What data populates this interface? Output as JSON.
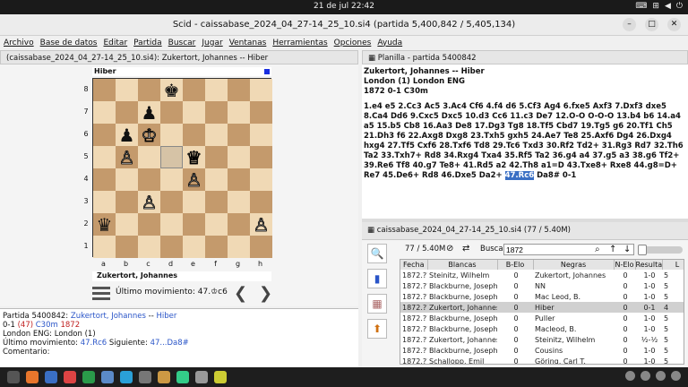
{
  "system": {
    "clock": "21 de jul  22:42",
    "tray_icons": [
      "language-icon",
      "network-icon",
      "volume-icon",
      "power-icon"
    ]
  },
  "window": {
    "title": "Scid - caissabase_2024_04_27-14_25_10.si4 (partida 5,400,842 / 5,405,134)",
    "controls": [
      "minimize-icon",
      "maximize-icon",
      "close-icon"
    ]
  },
  "menu": [
    "Archivo",
    "Base de datos",
    "Editar",
    "Partida",
    "Buscar",
    "Jugar",
    "Ventanas",
    "Herramientas",
    "Opciones",
    "Ayuda"
  ],
  "board_tab": {
    "label": "(caissabase_2024_04_27-14_25_10.si4): Zukertort, Johannes -- Hiber"
  },
  "board": {
    "top_player": "Hiber",
    "bottom_player": "Zukertort, Johannes",
    "ranks": [
      "8",
      "7",
      "6",
      "5",
      "4",
      "3",
      "2",
      "1"
    ],
    "files": [
      "a",
      "b",
      "c",
      "d",
      "e",
      "f",
      "g",
      "h"
    ],
    "last_move_label": "Último movimiento: 47.♔c6",
    "pieces": [
      {
        "square": "d8",
        "glyph": "♚",
        "color": "black"
      },
      {
        "square": "c7",
        "glyph": "♟",
        "color": "black"
      },
      {
        "square": "b6",
        "glyph": "♟",
        "color": "black"
      },
      {
        "square": "c6",
        "glyph": "♔",
        "color": "white"
      },
      {
        "square": "b5",
        "glyph": "♙",
        "color": "white"
      },
      {
        "square": "e5",
        "glyph": "♕",
        "color": "white"
      },
      {
        "square": "e4",
        "glyph": "♙",
        "color": "white"
      },
      {
        "square": "c3",
        "glyph": "♙",
        "color": "white"
      },
      {
        "square": "a2",
        "glyph": "♛",
        "color": "black"
      },
      {
        "square": "h2",
        "glyph": "♙",
        "color": "white"
      }
    ],
    "highlight": "d5"
  },
  "game_info": {
    "l1_pre": "Partida 5400842:  ",
    "white": "Zukertort, Johannes",
    "sep": "  --  ",
    "black": "Hiber",
    "l2_res": "0-1 ",
    "l2_num": "(47)",
    "l2_eco": "   C30m   ",
    "l2_elo": "1872",
    "l3": "London ENG:  London (1)",
    "l4_pre": "Último movimiento: ",
    "l4_last": "47.Rc6",
    "l4_mid": "   Siguiente: ",
    "l4_next": "47...Da8#",
    "l5": "Comentario:"
  },
  "notation_tab": {
    "label": "Planilla - partida 5400842"
  },
  "notation": {
    "header1": "Zukertort, Johannes   --   Hiber",
    "header2": "London (1)  London ENG",
    "header3": "1872  0-1  C30m",
    "moves_before": "1.e4 e5 2.Cc3 Ac5 3.Ac4 Cf6 4.f4 d6 5.Cf3 Ag4 6.fxe5 Axf3 7.Dxf3 dxe5 8.Ca4 Dd6 9.Cxc5 Dxc5 10.d3 Cc6 11.c3 De7 12.O-O O-O-O 13.b4 b6 14.a4 a5 15.b5 Cb8 16.Aa3 De8 17.Dg3 Tg8 18.Tf5 Cbd7 19.Tg5 g6 20.Tf1 Ch5 21.Dh3 f6 22.Axg8 Dxg8 23.Txh5 gxh5 24.Ae7 Te8 25.Axf6 Dg4 26.Dxg4 hxg4 27.Tf5 Cxf6 28.Txf6 Td8 29.Tc6 Txd3 30.Rf2 Td2+ 31.Rg3 Rd7 32.Th6 Ta2 33.Txh7+ Rd8 34.Rxg4 Txa4 35.Rf5 Ta2 36.g4 a4 37.g5 a3 38.g6 Tf2+ 39.Re6 Tf8 40.g7 Te8+ 41.Rd5 a2 42.Th8 a1=D 43.Txe8+ Rxe8 44.g8=D+ Re7 45.De6+ Rd8 46.Dxe5 Da2+ ",
    "current_move": "47.Rc6",
    "moves_after": " Da8# 0-1"
  },
  "db_tab": {
    "label": "caissabase_2024_04_27-14_25_10.si4 (77 / 5.40M)"
  },
  "side_buttons": [
    "zoom-icon",
    "stats-icon",
    "board-icon",
    "export-icon"
  ],
  "filter": {
    "count": "77 / 5.40M",
    "search_label": "Buscar",
    "search_value": "1872"
  },
  "table": {
    "columns": [
      "Fecha",
      "Blancas",
      "B-Elo",
      "Negras",
      "N-Elo",
      "Resulta",
      "L"
    ],
    "rows": [
      [
        "1872.??.??",
        "Steinitz, Wilhelm",
        "0",
        "Zukertort, Johannes",
        "0",
        "1-0",
        "5"
      ],
      [
        "1872.??.??",
        "Blackburne, Joseph",
        "0",
        "NN",
        "0",
        "1-0",
        "5"
      ],
      [
        "1872.??.??",
        "Blackburne, Joseph",
        "0",
        "Mac Leod, B.",
        "0",
        "1-0",
        "5"
      ],
      [
        "1872.??.??",
        "Zukertort, Johannes",
        "0",
        "Hiber",
        "0",
        "0-1",
        "4"
      ],
      [
        "1872.??.??",
        "Blackburne, Joseph",
        "0",
        "Puller",
        "0",
        "1-0",
        "5"
      ],
      [
        "1872.??.??",
        "Blackburne, Joseph",
        "0",
        "Macleod, B.",
        "0",
        "1-0",
        "5"
      ],
      [
        "1872.??.??",
        "Zukertort, Johannes",
        "0",
        "Steinitz, Wilhelm",
        "0",
        "½-½",
        "5"
      ],
      [
        "1872.??.??",
        "Blackburne, Joseph",
        "0",
        "Cousins",
        "0",
        "1-0",
        "5"
      ],
      [
        "1872.??.??",
        "Schallopp, Emil",
        "0",
        "Göring, Carl T.",
        "0",
        "1-0",
        "5"
      ]
    ],
    "selected_row": 3
  }
}
